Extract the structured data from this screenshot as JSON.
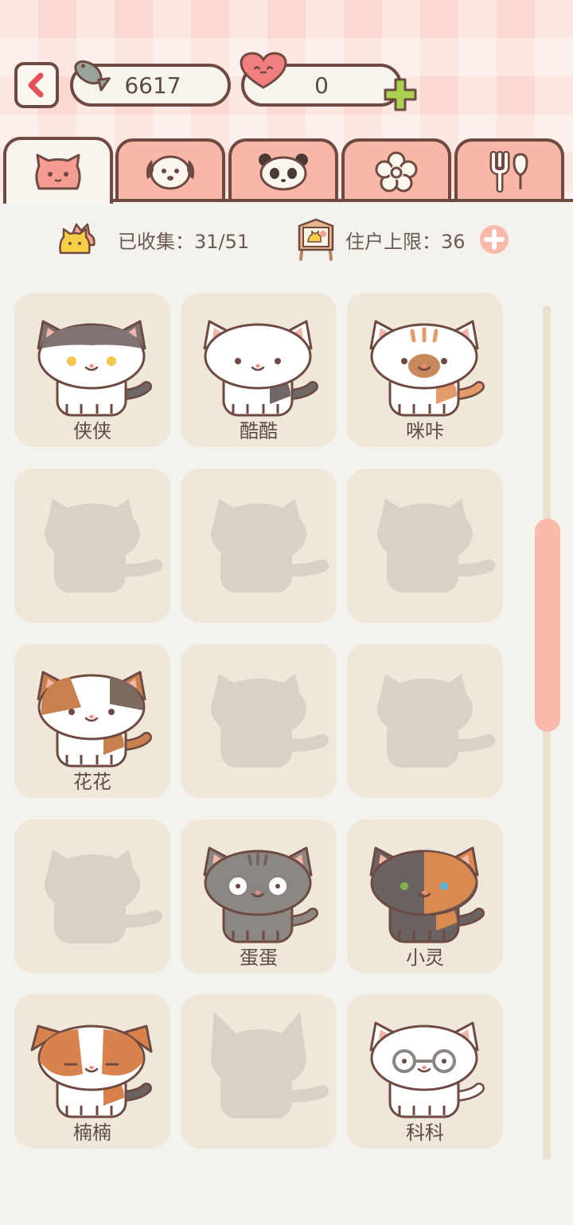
{
  "currency": {
    "fish": "6617",
    "hearts": "0"
  },
  "tabs": [
    {
      "icon": "cat-tab-icon",
      "active": true
    },
    {
      "icon": "dog-tab-icon",
      "active": false
    },
    {
      "icon": "panda-tab-icon",
      "active": false
    },
    {
      "icon": "flower-tab-icon",
      "active": false
    },
    {
      "icon": "utensils-tab-icon",
      "active": false
    }
  ],
  "stats": {
    "collected": "已收集：31/51",
    "resident_limit": "住户上限：36"
  },
  "cats": [
    {
      "name": "侠侠",
      "unlocked": true
    },
    {
      "name": "酷酷",
      "unlocked": true
    },
    {
      "name": "咪咔",
      "unlocked": true
    },
    {
      "name": "",
      "unlocked": false
    },
    {
      "name": "",
      "unlocked": false
    },
    {
      "name": "",
      "unlocked": false
    },
    {
      "name": "花花",
      "unlocked": true
    },
    {
      "name": "",
      "unlocked": false
    },
    {
      "name": "",
      "unlocked": false
    },
    {
      "name": "",
      "unlocked": false
    },
    {
      "name": "蛋蛋",
      "unlocked": true
    },
    {
      "name": "小灵",
      "unlocked": true
    },
    {
      "name": "楠楠",
      "unlocked": true
    },
    {
      "name": "",
      "unlocked": false
    },
    {
      "name": "科科",
      "unlocked": true
    }
  ],
  "colors": {
    "accent": "#f9b7a9",
    "outline": "#6e4a42",
    "card": "#efe7da",
    "silhouette": "#d8d2c6"
  }
}
